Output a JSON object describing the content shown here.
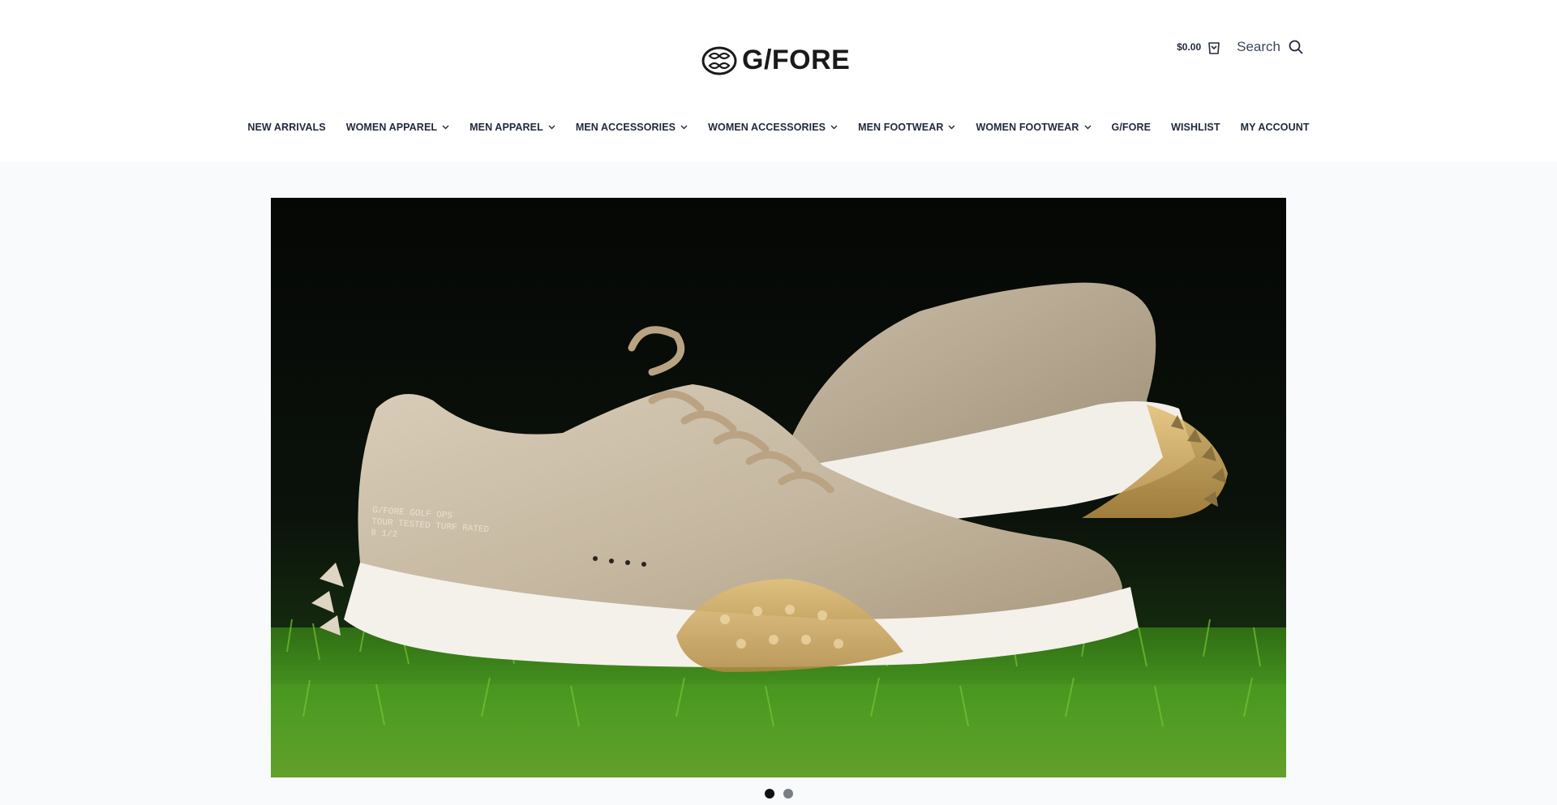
{
  "brand": {
    "logo_text": "G/FORE"
  },
  "header": {
    "cart_total": "$0.00",
    "search_label": "Search"
  },
  "nav": {
    "items": [
      {
        "label": "NEW ARRIVALS",
        "has_dropdown": false
      },
      {
        "label": "WOMEN APPAREL",
        "has_dropdown": true
      },
      {
        "label": "MEN APPAREL",
        "has_dropdown": true
      },
      {
        "label": "MEN ACCESSORIES",
        "has_dropdown": true
      },
      {
        "label": "WOMEN ACCESSORIES",
        "has_dropdown": true
      },
      {
        "label": "MEN FOOTWEAR",
        "has_dropdown": true
      },
      {
        "label": "WOMEN FOOTWEAR",
        "has_dropdown": true
      },
      {
        "label": "G/FORE",
        "has_dropdown": false
      },
      {
        "label": "WISHLIST",
        "has_dropdown": false
      },
      {
        "label": "MY ACCOUNT",
        "has_dropdown": false
      }
    ]
  },
  "hero": {
    "shoe_print": [
      "G/FORE GOLF OPS",
      "TOUR TESTED TURF RATED",
      "8 1/2"
    ],
    "slides_count": 2,
    "active_slide": 1
  },
  "colors": {
    "nav_text": "#1f2a3a",
    "page_bg": "#f8fafc",
    "turf": "#3d8a1f",
    "shoe": "#cfc3b1"
  },
  "icons": [
    "cart-icon",
    "search-icon",
    "chevron-down-icon"
  ]
}
